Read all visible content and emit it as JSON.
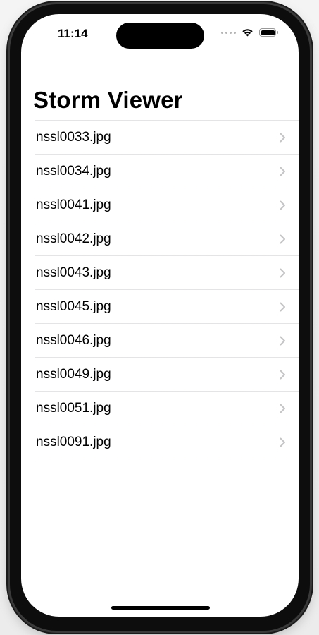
{
  "status_bar": {
    "time": "11:14"
  },
  "nav": {
    "title": "Storm Viewer"
  },
  "list": {
    "items": [
      {
        "label": "nssl0033.jpg"
      },
      {
        "label": "nssl0034.jpg"
      },
      {
        "label": "nssl0041.jpg"
      },
      {
        "label": "nssl0042.jpg"
      },
      {
        "label": "nssl0043.jpg"
      },
      {
        "label": "nssl0045.jpg"
      },
      {
        "label": "nssl0046.jpg"
      },
      {
        "label": "nssl0049.jpg"
      },
      {
        "label": "nssl0051.jpg"
      },
      {
        "label": "nssl0091.jpg"
      }
    ]
  },
  "icons": {
    "disclosure": "chevron-right-icon",
    "wifi": "wifi-icon",
    "battery": "battery-icon",
    "signal": "cellular-signal-icon"
  },
  "colors": {
    "separator": "#e4e4e6",
    "chevron": "#c4c4c7",
    "text": "#000000",
    "background": "#ffffff"
  }
}
